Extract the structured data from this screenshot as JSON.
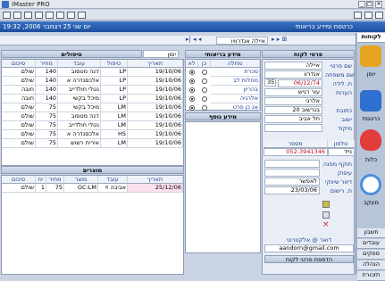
{
  "window": {
    "title": "iMaster PRO"
  },
  "datebar": {
    "date": "יום שני 25 דצמבר 2006, 19:32",
    "section": "כרטסת ומידע בריאותי"
  },
  "toolbar": {
    "icons": [
      "save-icon",
      "list-icon",
      "window-icon",
      "layout-icon",
      "grid-icon",
      "image-icon",
      "print-icon",
      "help-icon"
    ]
  },
  "nav": {
    "record": "איילה אנדרוויו",
    "day_label": "יומן"
  },
  "sidebar": {
    "top": "לקוחות",
    "items": [
      {
        "label": "יומן",
        "icon": "clipboard-icon",
        "color": "#e6a420"
      },
      {
        "label": "כרטסת",
        "icon": "card-icon",
        "color": "#2f6fcf"
      },
      {
        "label": "כלות",
        "icon": "heart-icon",
        "color": "#e23c3c"
      },
      {
        "label": "מעקב",
        "icon": "magnifier-icon",
        "color": "#4a8fe0"
      }
    ],
    "bottom": [
      "חשבון",
      "עובדים",
      "ספקים",
      "הנהלה",
      "תזכורת"
    ]
  },
  "client": {
    "header": "פרטי לקוח",
    "fields": [
      {
        "label": "שם פרטי",
        "value": "איילה"
      },
      {
        "label": "שם משפחה",
        "value": "אנדרוו"
      },
      {
        "label": "ת. לידה",
        "value": "06/12/74"
      },
      {
        "label": "הערות",
        "value": "עור רגיש"
      },
      {
        "label": "",
        "value": "אלרגי"
      },
      {
        "label": "כתובת",
        "value": "בגרשוב 20"
      },
      {
        "label": "ישוב",
        "value": "תל אביב"
      },
      {
        "label": "מיקוד",
        "value": ""
      }
    ],
    "age": "35",
    "phones_header": [
      "טלפון",
      "מספר"
    ],
    "phone_type": "נייד",
    "phone": "052-3941346",
    "extra": [
      {
        "label": "תוקף מפנה",
        "value": ""
      },
      {
        "label": "עיסוק",
        "value": ""
      },
      {
        "label": "דיוור שיווקי",
        "value": "לאפשר"
      },
      {
        "label": "ת. רישום",
        "value": "23/03/06"
      }
    ],
    "email_label": "דואר @ אלקטרוני",
    "email": "aandorn@gmail.com",
    "print_button": "הדפסת פרטי לקוח"
  },
  "health": {
    "header": "מידע בריאותי",
    "columns": [
      "מחלה",
      "כן",
      "לא"
    ],
    "rows": [
      {
        "name": "סכרת",
        "yes": false
      },
      {
        "name": "מחלות לב",
        "yes": false
      },
      {
        "name": "בהריון",
        "yes": false
      },
      {
        "name": "אלרגיה",
        "yes": false
      },
      {
        "name": "אנ כן פרט",
        "yes": false
      }
    ],
    "extra_header": "מידע נוסף"
  },
  "treatments": {
    "header": "טיפולים",
    "columns": [
      "תאריך",
      "טיפול",
      "עובד",
      "מחיר",
      "סיכום"
    ],
    "rows": [
      {
        "date": "19/10/06",
        "code": "LP",
        "worker": "ז'נה מטסוב",
        "price": "140",
        "status": "שולם"
      },
      {
        "date": "19/10/06",
        "code": "LP",
        "worker": "אלכסנדרה א",
        "price": "140",
        "status": "שולם"
      },
      {
        "date": "19/10/06",
        "code": "LP",
        "worker": "נטלי חולדייב",
        "price": "140",
        "status": "חובה"
      },
      {
        "date": "19/10/06",
        "code": "LP",
        "worker": "מיכל בקשי",
        "price": "140",
        "status": "חובה"
      },
      {
        "date": "19/10/06",
        "code": "LM",
        "worker": "מיכל בקשי",
        "price": "75",
        "status": "שולם"
      },
      {
        "date": "19/10/06",
        "code": "LM",
        "worker": "ז'נה מטסוב",
        "price": "75",
        "status": "שולם"
      },
      {
        "date": "19/10/06",
        "code": "LM",
        "worker": "נטלי חולדייב",
        "price": "75",
        "status": "שולם"
      },
      {
        "date": "19/10/06",
        "code": "HS",
        "worker": "אלכסנדרה א",
        "price": "75",
        "status": "שולם"
      },
      {
        "date": "19/10/06",
        "code": "LM",
        "worker": "אירית רשוש",
        "price": "75",
        "status": "שולם"
      }
    ]
  },
  "products": {
    "header": "מוצרים",
    "columns": [
      "תאריך",
      "עובד",
      "מוצר",
      "מחיר",
      "יח",
      "סיכום"
    ],
    "rows": [
      {
        "date": "25/12/06",
        "worker": "אביבה זי",
        "product": "GC:LM",
        "price": "75",
        "qty": "1",
        "status": "שולם"
      }
    ]
  }
}
